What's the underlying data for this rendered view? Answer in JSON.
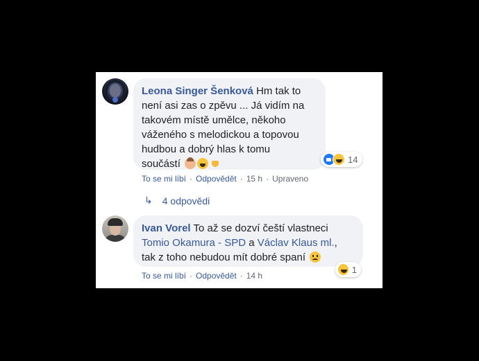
{
  "comments": [
    {
      "author": "Leona Singer Šenková",
      "lines": [
        "Hm tak to",
        "není asi zas o zpěvu ... Já vidím na",
        "takovém místě umělce, někoho",
        "váženého s melodickou a topovou",
        "hudbou a dobrý hlas k tomu",
        "součástí"
      ],
      "emojis": [
        "woman-face-icon",
        "crying-face-icon",
        "thumbs-down-icon"
      ],
      "reactions": {
        "icons": [
          "like-icon",
          "haha-icon"
        ],
        "count": "14"
      },
      "actions": {
        "like": "To se mi líbí",
        "reply": "Odpovědět",
        "time": "15 h",
        "edited": "Upraveno",
        "separator": "·"
      }
    },
    {
      "author": "Ivan Vorel",
      "text_before": "To až se dozví čeští vlastneci",
      "mention1": "Tomio Okamura - SPD",
      "connector": "a",
      "mention2": "Václav Klaus ml.",
      "text_after": ",",
      "line3": "tak z toho nebudou mít dobré spaní",
      "emojis": [
        "confused-face-icon"
      ],
      "reactions": {
        "icons": [
          "haha-icon"
        ],
        "count": "1"
      },
      "actions": {
        "like": "To se mi líbí",
        "reply": "Odpovědět",
        "time": "14 h",
        "separator": "·"
      }
    }
  ],
  "replies": {
    "label": "4 odpovědi",
    "icon": "reply-arrow-icon"
  },
  "colors": {
    "link": "#385898",
    "bubble": "#f0f2f5",
    "meta": "#606770",
    "like": "#2078f4"
  }
}
